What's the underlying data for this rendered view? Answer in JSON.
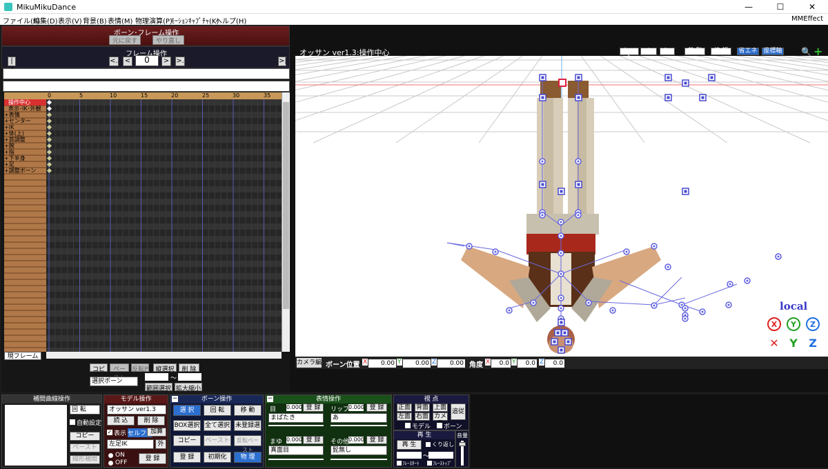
{
  "window": {
    "title": "MikuMikuDance",
    "minimize": "—",
    "maximize": "☐",
    "close": "✕"
  },
  "menu": [
    "ファイル(F)",
    "編集(D)",
    "表示(V)",
    "背景(B)",
    "表情(M)",
    "物理演算(P)",
    "ﾓｰｼｮﾝｷｬﾌﾟﾁｬ(K)",
    "ヘルプ(H)"
  ],
  "menu_right": "MMEffect",
  "bone_frame": {
    "title": "ボーン･フレーム操作",
    "undo": "元に戻す",
    "redo": "やり直し"
  },
  "frame_op": {
    "title": "フレーム操作",
    "first": "|<",
    "prev_key": "<.",
    "prev": "<",
    "frame": "0",
    "next": ">",
    "next_key": ">.",
    "last": ">|"
  },
  "timeline": {
    "ticks": [
      "0",
      "5",
      "10",
      "15",
      "20",
      "25",
      "30",
      "35"
    ],
    "tracks": [
      "操作中心",
      "表示･IK･外観",
      "+表情",
      "+センター",
      "+IK",
      "+体(上)",
      "+首調整",
      "+腕",
      "+指",
      "+下半身",
      "+足",
      "+調整ボーン"
    ]
  },
  "current_frame_label": "現フレーム",
  "edit_buttons": {
    "copy": "コピー",
    "paste": "ペースト",
    "reverse_paste": "反転P",
    "vertical_select": "縦選択",
    "delete": "削 除",
    "selection_mode": "選択ボーン",
    "range_select": "範囲選択",
    "zoom": "拡大縮小",
    "range_sep": "〜"
  },
  "viewport": {
    "title": "オッサン ver1.3:操作中心",
    "set": "セット",
    "set_value": "0",
    "go": "Go",
    "beauty": "美 影",
    "info": "情 報",
    "eco": "省エネ",
    "axis": "座標軸",
    "local": "local"
  },
  "bottombar": {
    "camera": "カメラ編",
    "bone_pos": "ボーン位置",
    "x": "0.00",
    "y": "0.00",
    "z": "0.00",
    "angle": "角度",
    "ax": "0.0",
    "ay": "0.0",
    "az": "0.0"
  },
  "interp": {
    "title": "補間曲線操作",
    "rotate": "回 転",
    "auto": "自動設定",
    "copy": "コピー",
    "paste": "ペースト",
    "linear": "線形補間"
  },
  "model": {
    "title": "モデル操作",
    "model_name": "オッサン ver1.3",
    "load": "読 込",
    "delete": "削 除",
    "show": "表示",
    "self_shadow": "セルフ影",
    "add": "加算",
    "bone": "左足IK",
    "outer": "外",
    "on": "ON",
    "off": "OFF",
    "register": "登 録"
  },
  "bone": {
    "title": "ボーン操作",
    "select": "選 択",
    "rotate": "回 転",
    "move": "移 動",
    "box_select": "BOX選択",
    "select_all": "全て選択",
    "unregistered": "未登録選",
    "copy": "コピー",
    "paste": "ペースト",
    "reverse_paste": "反転ペースト",
    "register": "登 録",
    "init": "初期化",
    "physics": "物 理"
  },
  "expression": {
    "title": "表情操作",
    "eye": "目",
    "eye_val": "0.000",
    "eye_sel": "まばたき",
    "lip": "リップ",
    "lip_val": "0.000",
    "lip_sel": "あ",
    "brow": "まゆ",
    "brow_val": "0.000",
    "brow_sel": "真面目",
    "other": "その他",
    "other_val": "0.000",
    "other_sel": "髭無し",
    "register": "登 録"
  },
  "view": {
    "title": "視 点",
    "front": "正面",
    "back": "背面",
    "top": "上面",
    "left": "左面",
    "right": "右面",
    "camera": "カメラ",
    "follow": "追従",
    "model": "モデル",
    "bone": "ボーン"
  },
  "play": {
    "title": "再 生",
    "play": "再 生",
    "loop": "くり返し",
    "frame_start": "ﾌﾚｰｽﾀｰﾄ",
    "frame_stop": "ﾌﾚｰｽﾄｯﾌﾟ",
    "range_sep": "〜"
  },
  "volume": {
    "title": "音量"
  }
}
